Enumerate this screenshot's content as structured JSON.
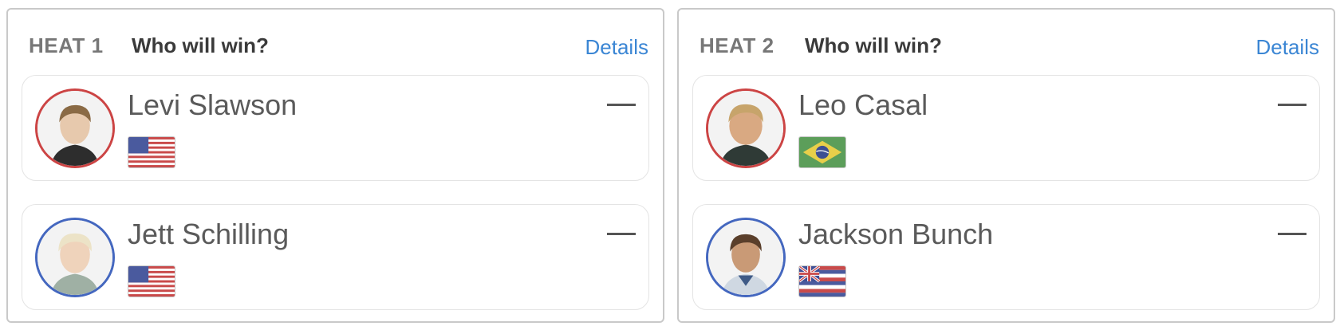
{
  "heats": [
    {
      "label": "HEAT 1",
      "question": "Who will win?",
      "details_label": "Details",
      "surfers": [
        {
          "name": "Levi Slawson",
          "flag": "usa-flag-icon",
          "ring_color": "#cc4444",
          "pick": "—"
        },
        {
          "name": "Jett Schilling",
          "flag": "usa-flag-icon",
          "ring_color": "#4467bf",
          "pick": "—"
        }
      ]
    },
    {
      "label": "HEAT 2",
      "question": "Who will win?",
      "details_label": "Details",
      "surfers": [
        {
          "name": "Leo Casal",
          "flag": "brazil-flag-icon",
          "ring_color": "#cc4444",
          "pick": "—"
        },
        {
          "name": "Jackson Bunch",
          "flag": "hawaii-flag-icon",
          "ring_color": "#4467bf",
          "pick": "—"
        }
      ]
    }
  ],
  "colors": {
    "accent": "#3b86d4",
    "red_ring": "#cc4444",
    "blue_ring": "#4467bf"
  }
}
